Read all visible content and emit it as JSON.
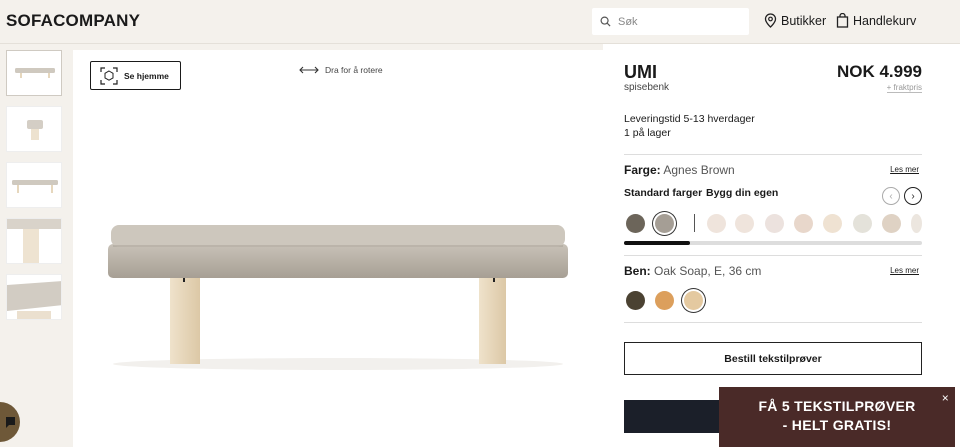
{
  "header": {
    "logo": "SOFACOMPANY",
    "search_placeholder": "Søk",
    "stores_label": "Butikker",
    "cart_label": "Handlekurv"
  },
  "viewer": {
    "see_home_label": "Se hjemme",
    "rotate_hint": "Dra for å rotere"
  },
  "product": {
    "name": "UMI",
    "subtitle": "spisebenk",
    "price": "NOK 4.999",
    "freight": "+ fraktpris",
    "delivery": "Leveringstid 5-13 hverdager",
    "stock": "1 på lager"
  },
  "color": {
    "label": "Farge:",
    "value": "Agnes Brown",
    "read_more": "Les mer",
    "tabs": [
      "Standard farger",
      "Bygg din egen"
    ],
    "swatches": [
      "#6c655a",
      "#a59e95",
      "#efe4dc",
      "#efe4dc",
      "#ece2de",
      "#e8d7cb",
      "#efe2d2",
      "#e4e2da",
      "#dfd2c4",
      "#ece6df"
    ],
    "scroll_progress": 0.22
  },
  "legs": {
    "label": "Ben:",
    "value": "Oak Soap, E, 36 cm",
    "read_more": "Les mer",
    "swatches": [
      "#4b4232",
      "#dc9f5c",
      "#e4c9a0"
    ]
  },
  "actions": {
    "order_samples": "Bestill tekstilprøver"
  },
  "promo": {
    "line1": "FÅ 5 TEKSTILPRØVER",
    "line2": "- HELT GRATIS!",
    "close": "×"
  }
}
